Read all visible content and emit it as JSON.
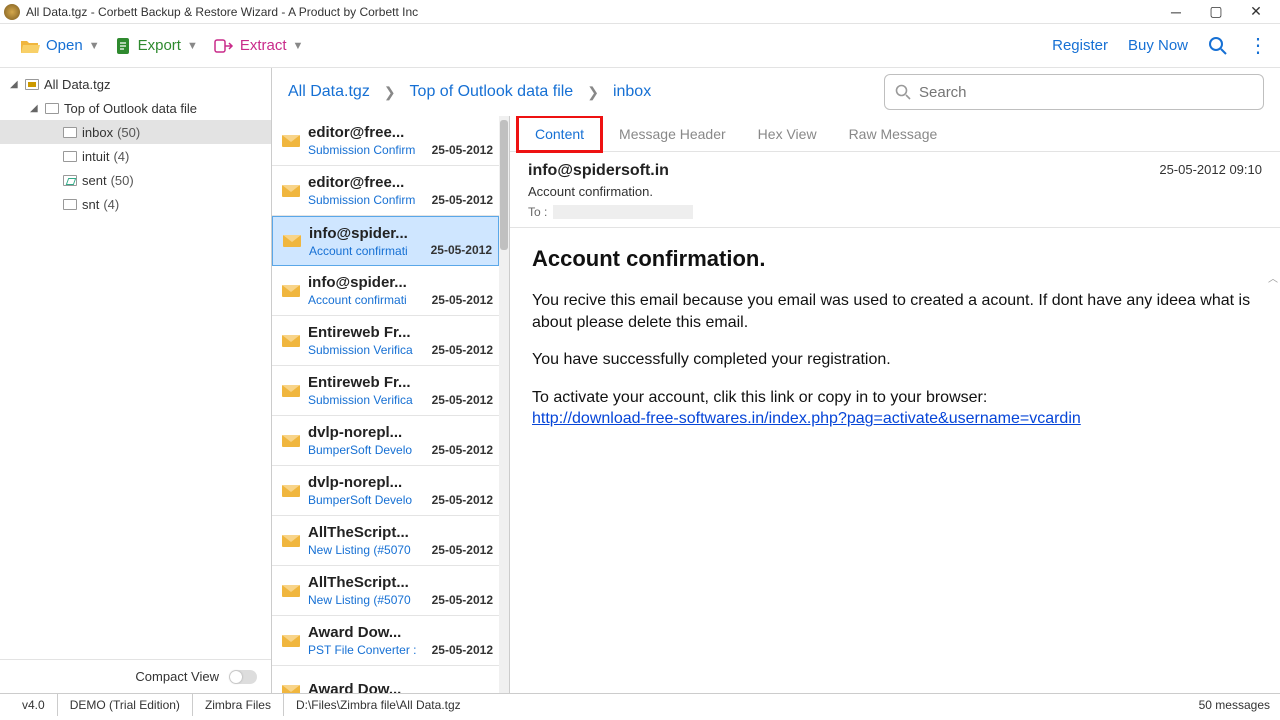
{
  "window": {
    "title": "All Data.tgz - Corbett Backup & Restore Wizard - A Product by Corbett Inc"
  },
  "toolbar": {
    "open": "Open",
    "export": "Export",
    "extract": "Extract",
    "register": "Register",
    "buynow": "Buy Now"
  },
  "tree": {
    "root": "All Data.tgz",
    "top": "Top of Outlook data file",
    "items": [
      {
        "label": "inbox",
        "count": "(50)",
        "selected": true,
        "type": "folder"
      },
      {
        "label": "intuit",
        "count": "(4)",
        "type": "folder"
      },
      {
        "label": "sent",
        "count": "(50)",
        "type": "sent"
      },
      {
        "label": "snt",
        "count": "(4)",
        "type": "folder"
      }
    ],
    "compact": "Compact View"
  },
  "breadcrumb": [
    "All Data.tgz",
    "Top of Outlook data file",
    "inbox"
  ],
  "search_placeholder": "Search",
  "messages": [
    {
      "from": "editor@free...",
      "subject": "Submission Confirm",
      "date": "25-05-2012"
    },
    {
      "from": "editor@free...",
      "subject": "Submission Confirm",
      "date": "25-05-2012"
    },
    {
      "from": "info@spider...",
      "subject": "Account confirmati",
      "date": "25-05-2012",
      "selected": true
    },
    {
      "from": "info@spider...",
      "subject": "Account confirmati",
      "date": "25-05-2012"
    },
    {
      "from": "Entireweb Fr...",
      "subject": "Submission Verifica",
      "date": "25-05-2012"
    },
    {
      "from": "Entireweb Fr...",
      "subject": "Submission Verifica",
      "date": "25-05-2012"
    },
    {
      "from": "dvlp-norepl...",
      "subject": "BumperSoft Develo",
      "date": "25-05-2012"
    },
    {
      "from": "dvlp-norepl...",
      "subject": "BumperSoft Develo",
      "date": "25-05-2012"
    },
    {
      "from": "AllTheScript...",
      "subject": "New Listing (#5070",
      "date": "25-05-2012"
    },
    {
      "from": "AllTheScript...",
      "subject": "New Listing (#5070",
      "date": "25-05-2012"
    },
    {
      "from": "Award Dow...",
      "subject": "PST File Converter :",
      "date": "25-05-2012"
    },
    {
      "from": "Award Dow...",
      "subject": "",
      "date": ""
    }
  ],
  "tabs": [
    "Content",
    "Message Header",
    "Hex View",
    "Raw Message"
  ],
  "reader": {
    "from": "info@spidersoft.in",
    "subject": "Account confirmation.",
    "to_label": "To :",
    "datetime": "25-05-2012 09:10",
    "body_title": "Account confirmation.",
    "p1": "You recive this email because you email was used to created a acount. If dont have any ideea what is about please delete this email.",
    "p2": "You have successfully completed your registration.",
    "p3": "To activate your account, clik this link or copy in to your browser:",
    "link": "http://download-free-softwares.in/index.php?pag=activate&username=vcardin"
  },
  "status": {
    "version": "v4.0",
    "edition": "DEMO (Trial Edition)",
    "mode": "Zimbra Files",
    "path": "D:\\Files\\Zimbra file\\All Data.tgz",
    "count": "50  messages"
  }
}
